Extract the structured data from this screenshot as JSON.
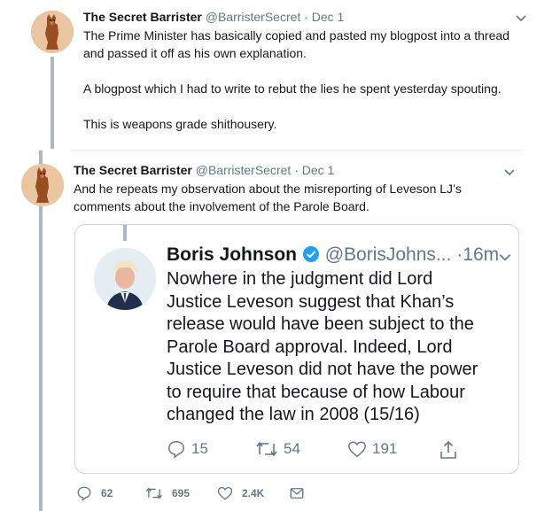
{
  "tweet1": {
    "name": "The Secret Barrister",
    "handle": "@BarristerSecret",
    "separator": "·",
    "date": "Dec 1",
    "lines": [
      "The Prime Minister has basically copied and pasted my blogpost into a thread",
      "and passed it off as his own explanation.",
      "A blogpost which I had to write to rebut the lies he spent yesterday spouting.",
      "This is weapons grade shithousery."
    ]
  },
  "tweet2": {
    "name": "The Secret Barrister",
    "handle": "@BarristerSecret",
    "separator": "·",
    "date": "Dec 1",
    "lines": [
      "And he repeats my observation about the misreporting of Leveson LJ’s",
      "comments about the involvement of the Parole Board."
    ],
    "actions": {
      "replies": "62",
      "retweets": "695",
      "likes": "2.4K"
    }
  },
  "quoted": {
    "name": "Boris Johnson",
    "handle": "@BorisJohns...",
    "separator": "·",
    "time": "16m",
    "lines": [
      "Nowhere in the judgment did Lord",
      "Justice Leveson suggest that Khan’s",
      "release would have been subject to the",
      "Parole Board approval. Indeed, Lord",
      "Justice Leveson did not have the power",
      "to require that because of how Labour",
      "changed the law in 2008 (15/16)"
    ],
    "actions": {
      "replies": "15",
      "retweets": "54",
      "likes": "191"
    }
  },
  "colors": {
    "text": "#14171a",
    "muted": "#657786",
    "verified": "#1da1f2",
    "thread": "#aab8c2",
    "border": "#ccd6dd"
  },
  "icons": [
    "chevron-down-icon",
    "reply-icon",
    "retweet-icon",
    "like-icon",
    "share-icon",
    "message-icon",
    "verified-badge-icon"
  ]
}
